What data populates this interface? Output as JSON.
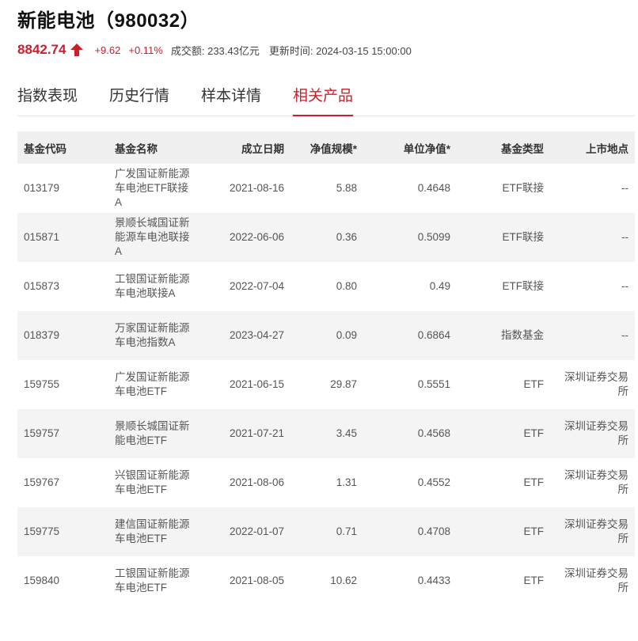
{
  "header": {
    "title": "新能电池（980032）",
    "price": "8842.74",
    "change": "+9.62",
    "change_pct": "+0.11%",
    "turnover": "成交额: 233.43亿元",
    "updated": "更新时间: 2024-03-15 15:00:00",
    "up_color": "#c9202c"
  },
  "tabs": [
    {
      "label": "指数表现"
    },
    {
      "label": "历史行情"
    },
    {
      "label": "样本详情"
    },
    {
      "label": "相关产品"
    }
  ],
  "active_tab": "相关产品",
  "table": {
    "columns": [
      "基金代码",
      "基金名称",
      "成立日期",
      "净值规模*",
      "单位净值*",
      "基金类型",
      "上市地点"
    ],
    "rows": [
      [
        "013179",
        "广发国证新能源车电池ETF联接A",
        "2021-08-16",
        "5.88",
        "0.4648",
        "ETF联接",
        "--"
      ],
      [
        "015871",
        "景顺长城国证新能源车电池联接A",
        "2022-06-06",
        "0.36",
        "0.5099",
        "ETF联接",
        "--"
      ],
      [
        "015873",
        "工银国证新能源车电池联接A",
        "2022-07-04",
        "0.80",
        "0.49",
        "ETF联接",
        "--"
      ],
      [
        "018379",
        "万家国证新能源车电池指数A",
        "2023-04-27",
        "0.09",
        "0.6864",
        "指数基金",
        "--"
      ],
      [
        "159755",
        "广发国证新能源车电池ETF",
        "2021-06-15",
        "29.87",
        "0.5551",
        "ETF",
        "深圳证券交易所"
      ],
      [
        "159757",
        "景顺长城国证新能电池ETF",
        "2021-07-21",
        "3.45",
        "0.4568",
        "ETF",
        "深圳证券交易所"
      ],
      [
        "159767",
        "兴银国证新能源车电池ETF",
        "2021-08-06",
        "1.31",
        "0.4552",
        "ETF",
        "深圳证券交易所"
      ],
      [
        "159775",
        "建信国证新能源车电池ETF",
        "2022-01-07",
        "0.71",
        "0.4708",
        "ETF",
        "深圳证券交易所"
      ],
      [
        "159840",
        "工银国证新能源车电池ETF",
        "2021-08-05",
        "10.62",
        "0.4433",
        "ETF",
        "深圳证券交易所"
      ]
    ]
  }
}
